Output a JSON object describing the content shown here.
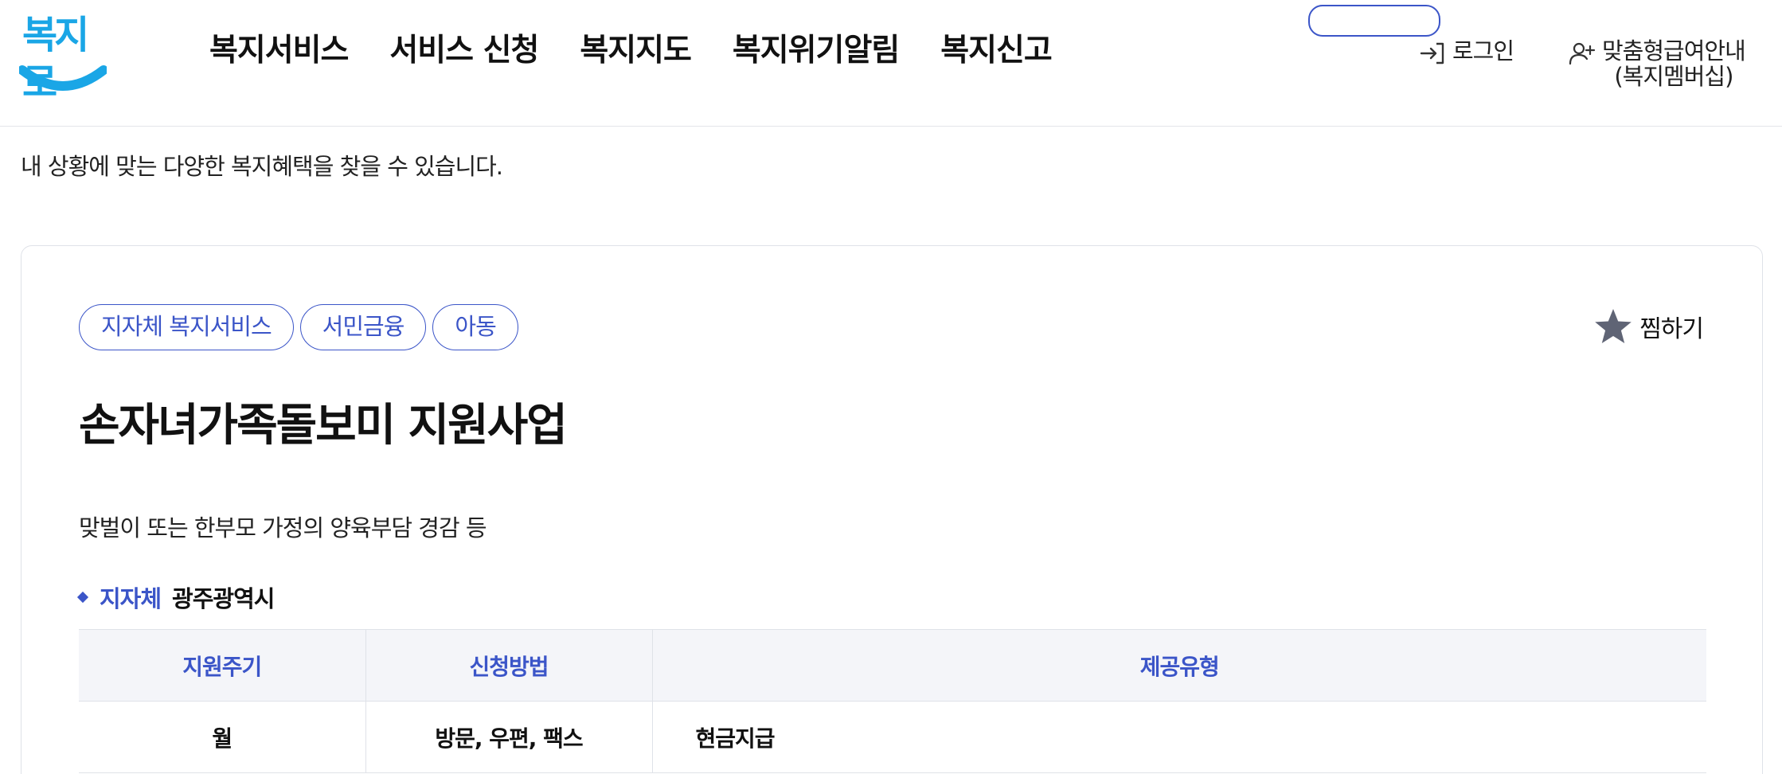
{
  "header": {
    "logo_text": "복지로",
    "nav": [
      "복지서비스",
      "서비스 신청",
      "복지지도",
      "복지위기알림",
      "복지신고"
    ],
    "login_label": "로그인",
    "member_line1": "맞춤형급여안내",
    "member_line2": "(복지멤버십)"
  },
  "page": {
    "subtitle": "내 상황에 맞는 다양한 복지혜택을 찾을 수 있습니다."
  },
  "service": {
    "tags": [
      "지자체 복지서비스",
      "서민금융",
      "아동"
    ],
    "favorite_label": "찜하기",
    "title": "손자녀가족돌보미 지원사업",
    "summary": "맞벌이 또는 한부모 가정의 양육부담 경감 등",
    "region_label": "지자체",
    "region_value": "광주광역시",
    "table": {
      "headers": [
        "지원주기",
        "신청방법",
        "제공유형"
      ],
      "rows": [
        [
          "월",
          "방문, 우편, 팩스",
          "현금지급"
        ]
      ]
    }
  },
  "colors": {
    "accent": "#3b55c8",
    "logo": "#1aa6e6",
    "table_header_bg": "#f4f5f9"
  },
  "icons": {
    "login": "login-arrow-icon",
    "member": "user-plus-icon",
    "favorite": "star-icon",
    "bullet": "diamond-bullet-icon"
  }
}
